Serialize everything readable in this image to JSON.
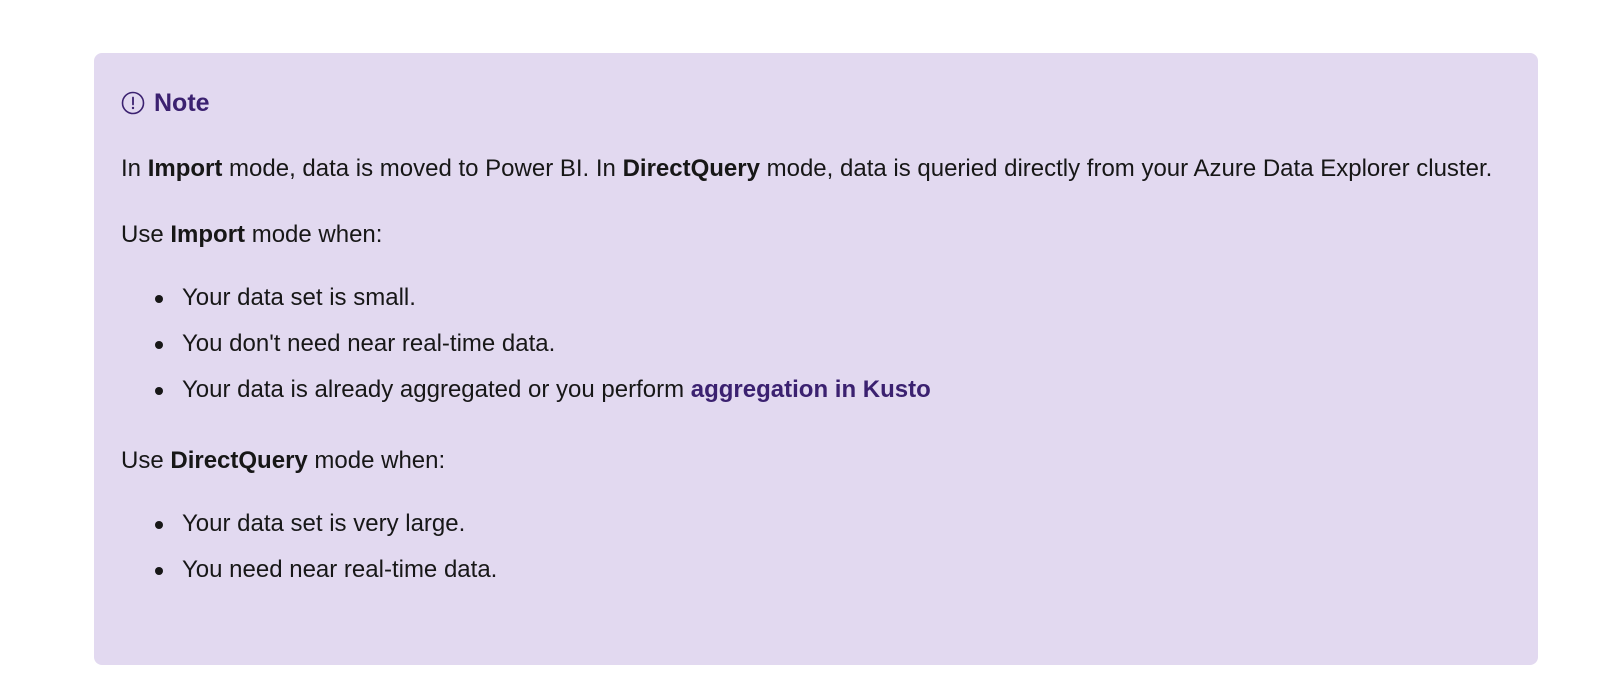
{
  "note": {
    "icon": "info-circle-icon",
    "title": "Note",
    "accent_color": "#3b2170",
    "background_color": "#e2d9f0",
    "intro": {
      "t1": "In ",
      "b1": "Import",
      "t2": " mode, data is moved to Power BI. In ",
      "b2": "DirectQuery",
      "t3": " mode, data is queried directly from your Azure Data Explorer cluster."
    },
    "import_heading": {
      "t1": "Use ",
      "b1": "Import",
      "t2": " mode when:"
    },
    "import_items": [
      "Your data set is small.",
      "You don't need near real-time data.",
      "Your data is already aggregated or you perform "
    ],
    "import_link": "aggregation in Kusto",
    "directquery_heading": {
      "t1": "Use ",
      "b1": "DirectQuery",
      "t2": " mode when:"
    },
    "directquery_items": [
      "Your data set is very large.",
      "You need near real-time data."
    ]
  }
}
